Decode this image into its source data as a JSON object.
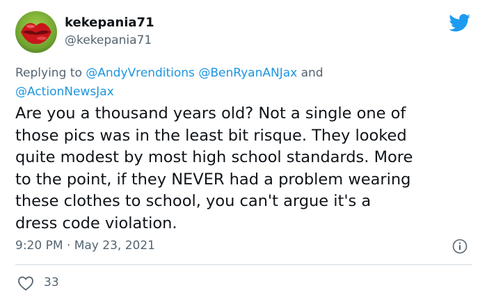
{
  "author": {
    "display_name": "kekepania71",
    "handle": "@kekepania71"
  },
  "reply": {
    "prefix": "Replying to",
    "mention_1": "@AndyVrenditions",
    "mention_2": "@BenRyanANJax",
    "conjunction": "and",
    "mention_3": "@ActionNewsJax"
  },
  "tweet": {
    "lines": [
      "Are you a thousand years old? Not a single one of",
      "those pics was in the least bit risque. They looked",
      "quite modest by most high school standards. More",
      "to the point, if they NEVER had a problem wearing",
      "these clothes to school, you can't argue it's a",
      "dress code violation."
    ]
  },
  "meta": {
    "timestamp": "9:20 PM · May 23, 2021"
  },
  "stats": {
    "likes": "33"
  },
  "colors": {
    "brand": "#1d9bf0",
    "mention": "#1b95e0",
    "secondary_text": "#536471",
    "divider": "#cfd9de"
  },
  "icons": {
    "brand": "twitter-bird-icon",
    "info": "info-icon",
    "like": "heart-icon",
    "avatar": "red-lips-avatar"
  }
}
